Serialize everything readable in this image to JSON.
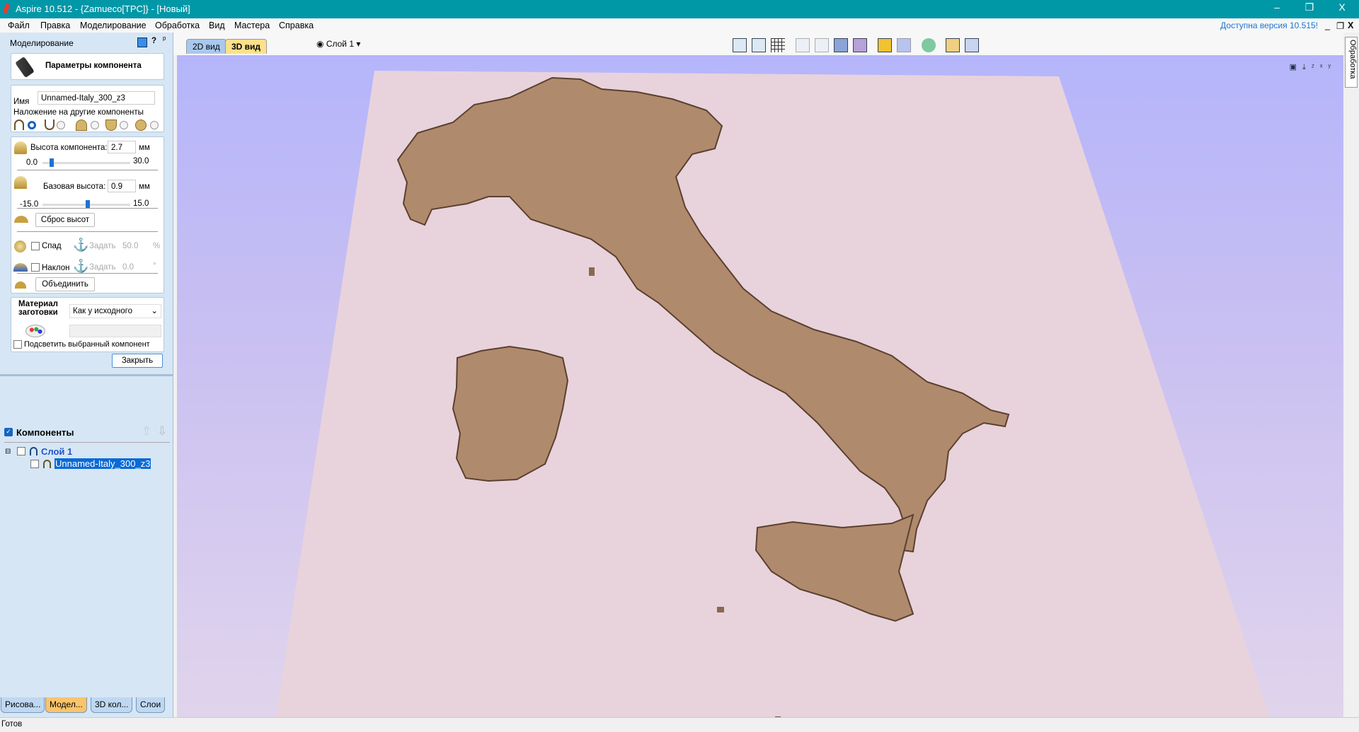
{
  "window": {
    "title": "Aspire 10.512 - {Zamueco[TPC]} - [Новый]",
    "minimize": "–",
    "restore": "❐",
    "close": "X"
  },
  "menu": {
    "items": [
      "Файл",
      "Правка",
      "Моделирование",
      "Обработка",
      "Вид",
      "Мастера",
      "Справка"
    ],
    "update_link": "Доступна версия 10.515!",
    "mdi_min": "_",
    "mdi_restore": "❐",
    "mdi_close": "X"
  },
  "panel": {
    "header": "Моделирование",
    "help": "?",
    "pin": "ᵖ",
    "title_button": "Параметры компонента",
    "name_label": "Имя",
    "name_value": "Unnamed-Italy_300_z3",
    "overlay_label": "Наложение на другие компоненты",
    "overlay_selected": 0,
    "height": {
      "label": "Высота компонента:",
      "value": "2.7",
      "unit": "мм",
      "min": "0.0",
      "max": "30.0",
      "level": 2.7
    },
    "base": {
      "label": "Базовая высота:",
      "value": "0.9",
      "unit": "мм",
      "min": "-15.0",
      "max": "15.0",
      "level": 0.9
    },
    "reset_button": "Сброс высот",
    "fade": {
      "label": "Спад",
      "set": "Задать",
      "value": "50.0",
      "unit": "%"
    },
    "tilt": {
      "label": "Наклон",
      "set": "Задать",
      "value": "0.0",
      "unit": "°"
    },
    "merge_button": "Объединить",
    "material_label_1": "Материал",
    "material_label_2": "заготовки",
    "material_value": "Как у исходного",
    "highlight_label": "Подсветить выбранный компонент",
    "close_button": "Закрыть",
    "components_header": "Компоненты",
    "tree": {
      "layer": "Слой 1",
      "item": "Unnamed-Italy_300_z3"
    }
  },
  "bottom_tabs": [
    "Рисова...",
    "Модел...",
    "3D кол...",
    "Слои"
  ],
  "active_bottom_tab": 1,
  "view_tabs": [
    "2D вид",
    "3D вид"
  ],
  "layer_dropdown": "Слой 1",
  "right_tab": "Обработка",
  "status": "Готов",
  "colors": {
    "title": "#0097a7",
    "accent": "#1e73d2",
    "relief": "#b08a6c",
    "board": "#e8d3dc"
  }
}
